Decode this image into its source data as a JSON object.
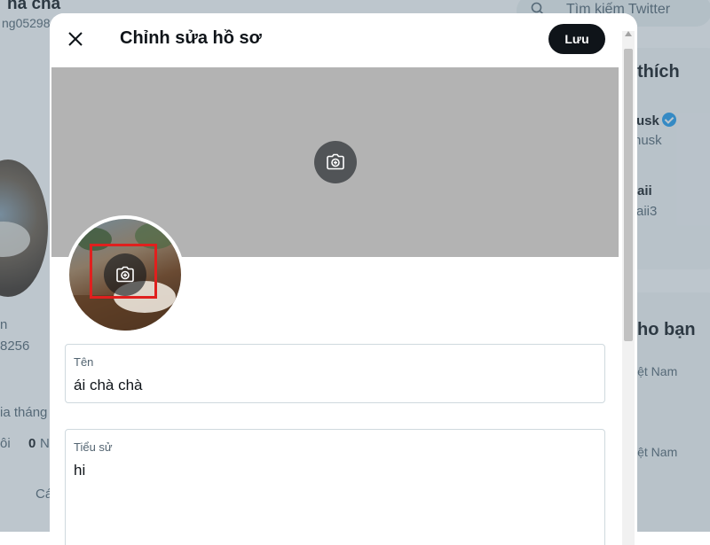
{
  "background": {
    "left_profile": {
      "name_fragment": "ha chà",
      "handle_fragment": "ng05298",
      "fragments": [
        "n",
        "8256",
        "ia tháng",
        "ôi",
        "0",
        "N",
        "Cá"
      ]
    },
    "right_sidebar": {
      "search_placeholder": "Tìm kiếm Twitter",
      "heading_1": "thích",
      "user_1_name": "usk",
      "user_1_handle": "nusk",
      "user_2_name": "aii",
      "user_2_handle": "aii3",
      "heading_2": "ho bạn",
      "loc_1": "iệt Nam",
      "loc_2": "iệt Nam"
    }
  },
  "modal": {
    "title": "Chỉnh sửa hồ sơ",
    "save_label": "Lưu",
    "fields": {
      "name": {
        "label": "Tên",
        "value": "ái chà chà"
      },
      "bio": {
        "label": "Tiểu sử",
        "value": "hi"
      }
    }
  },
  "colors": {
    "save_button_bg": "#0f1419",
    "banner_bg": "#b3b3b3",
    "highlight": "#e0201e",
    "verified": "#1d9bf0"
  },
  "icons": [
    "close-icon",
    "camera-add-icon",
    "search-icon",
    "verified-icon"
  ]
}
